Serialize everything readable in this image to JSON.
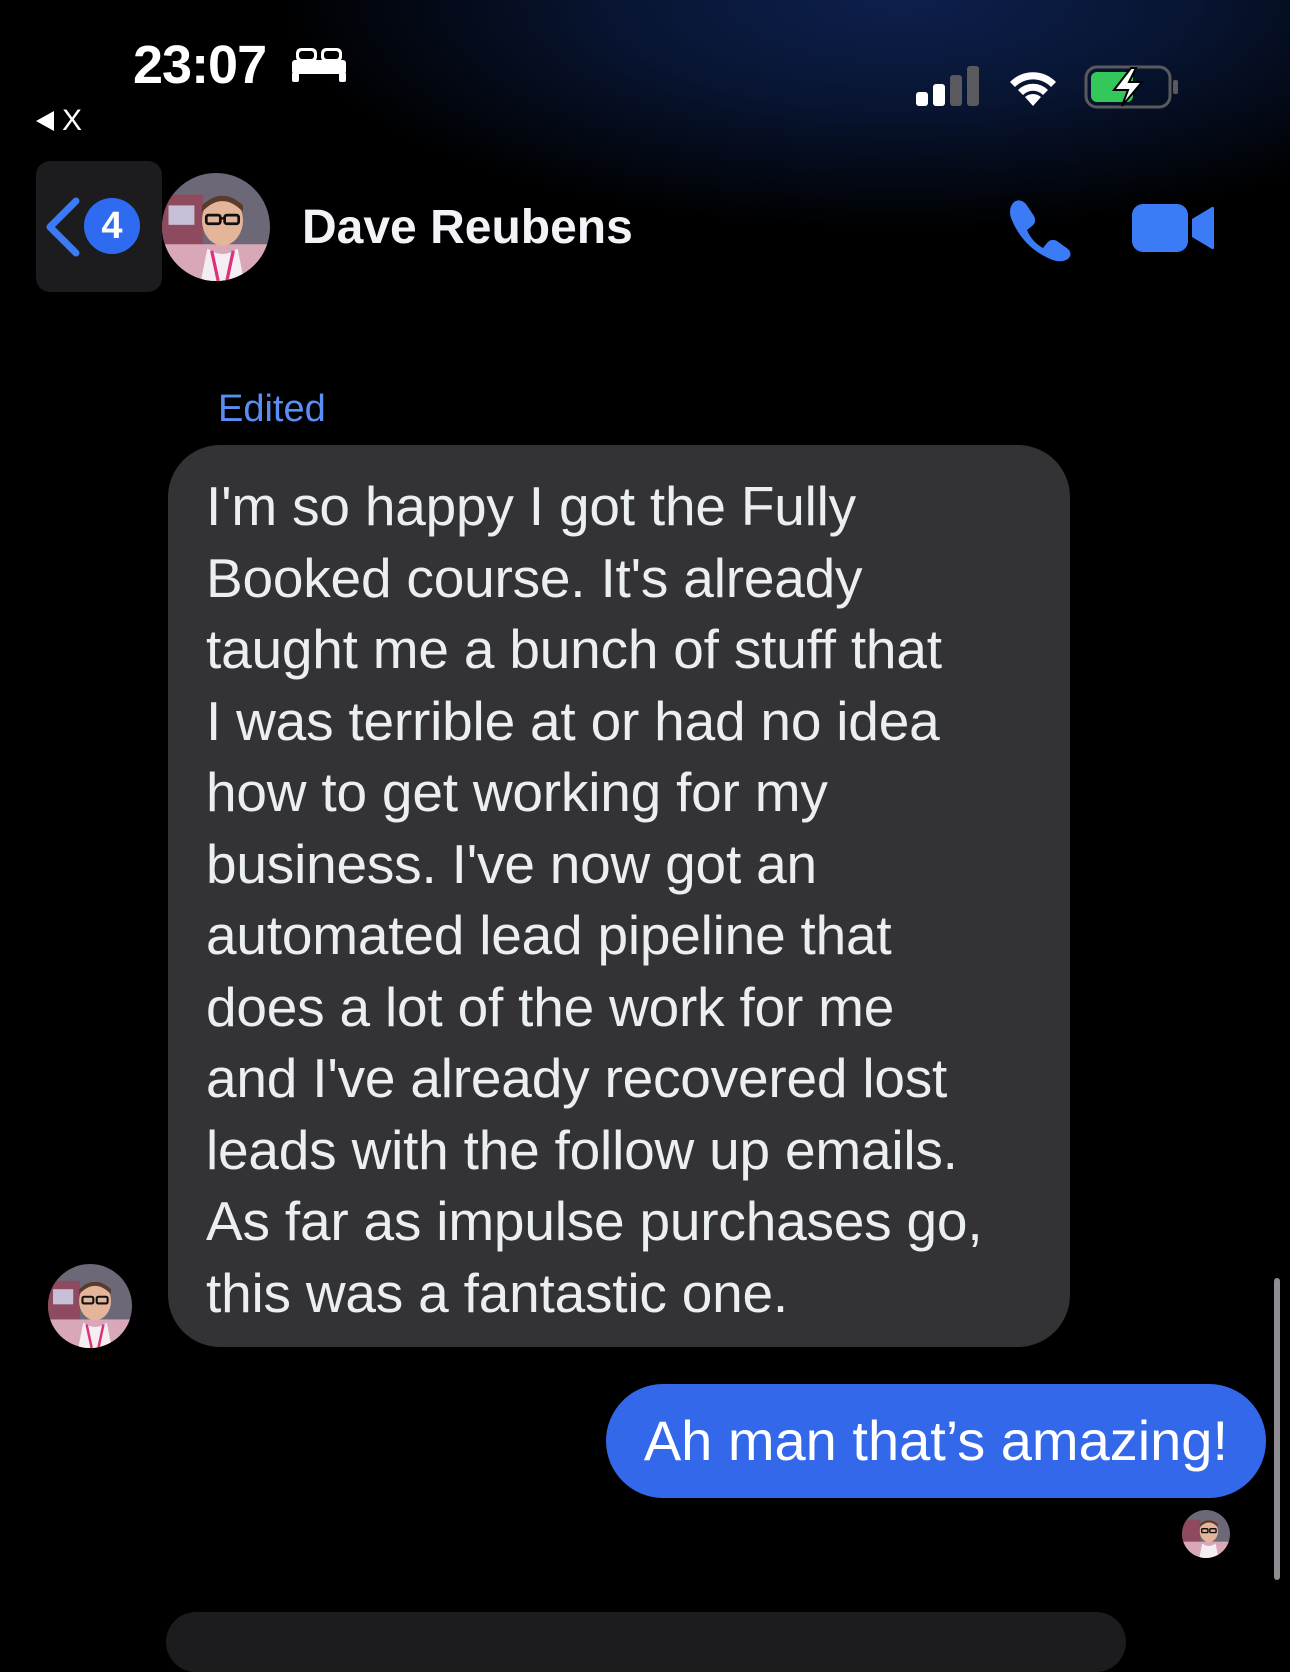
{
  "status_bar": {
    "time": "23:07",
    "focus_icon": "bed-icon",
    "back_app_label": "X",
    "signal_icon": "cellular-signal-icon",
    "wifi_icon": "wifi-icon",
    "battery_icon": "battery-charging-icon"
  },
  "header": {
    "unread_count": "4",
    "contact_name": "Dave Reubens",
    "call_icon": "phone-icon",
    "video_icon": "video-camera-icon"
  },
  "messages": {
    "edited_label": "Edited",
    "incoming_text": "I'm so happy I got the Fully\nBooked course. It's already\ntaught me a bunch of stuff that\nI was terrible at or had no idea\nhow to get working for my\nbusiness. I've now got an\nautomated lead pipeline that\ndoes a lot of the work for me\nand I've already recovered lost\nleads with the follow up emails.\nAs far as impulse purchases go,\nthis was a fantastic one.",
    "outgoing_text": "Ah man that’s amazing!"
  },
  "colors": {
    "background": "#000000",
    "incoming_bubble": "#333336",
    "outgoing_bubble": "#3468ea",
    "accent": "#2f6bf0",
    "edited_label": "#5b8ef5",
    "battery_green": "#34c759"
  }
}
